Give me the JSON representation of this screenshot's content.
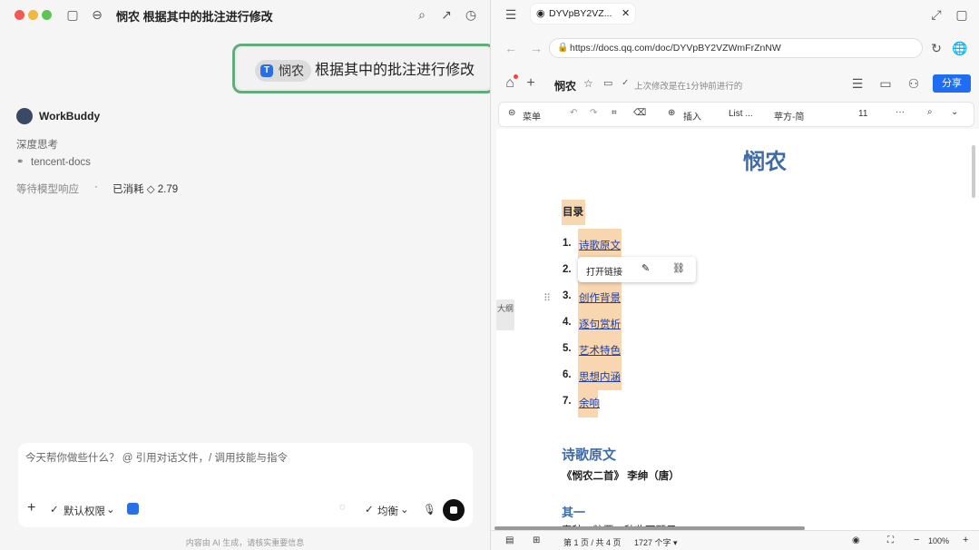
{
  "window": {
    "title": "悯农 根据其中的批注进行修改"
  },
  "chat": {
    "bubble_chip": "悯农",
    "bubble_chip_icon": "tencent-docs-icon",
    "bubble_text": "根据其中的批注进行修改",
    "assistant_name": "WorkBuddy",
    "thinking_label": "深度思考",
    "skill_label": "tencent-docs",
    "status_waiting": "等待模型响应",
    "status_dot": "·",
    "status_cost": "已消耗 ◇ 2.79"
  },
  "composer": {
    "placeholder": "今天帮你做些什么？ @ 引用对话文件，/ 调用技能与指令",
    "add_label": "+",
    "permission_label": "默认权限",
    "mode_label": "均衡",
    "disclaimer": "内容由 AI 生成，请核实重要信息"
  },
  "browser": {
    "tab_title": "DYVpBY2VZ...",
    "url": "https://docs.qq.com/doc/DYVpBY2VZWmFrZnNW"
  },
  "doc": {
    "name": "悯农",
    "save_status": "上次修改是在1分钟前进行的",
    "share_label": "分享",
    "toolbar": {
      "menu": "菜单",
      "insert": "插入",
      "list": "List ...",
      "font": "苹方-简",
      "size": "11",
      "more": "···"
    },
    "title": "悯农",
    "toc_heading": "目录",
    "toc": [
      {
        "num": "1.",
        "label": "诗歌原文"
      },
      {
        "num": "2.",
        "label": ""
      },
      {
        "num": "3.",
        "label": "创作背景"
      },
      {
        "num": "4.",
        "label": "逐句赏析"
      },
      {
        "num": "5.",
        "label": "艺术特色"
      },
      {
        "num": "6.",
        "label": "思想内涵"
      },
      {
        "num": "7.",
        "label": "余响"
      }
    ],
    "link_popup_open": "打开链接",
    "outline_tab": "大纲",
    "section_heading": "诗歌原文",
    "section_subline": "《悯农二首》 李绅（唐）",
    "sub_heading": "其一",
    "cut_line": "春种一粒粟，秋收万颗子。"
  },
  "status_bar": {
    "page": "第 1 页 / 共 4 页",
    "words": "1727 个字 ▾",
    "zoom": "100%"
  },
  "colors": {
    "accent_blue": "#1f6df2",
    "highlight": "#f8d6b0",
    "bubble_border": "#62ad7b",
    "heading_blue": "#3f6aa3"
  }
}
